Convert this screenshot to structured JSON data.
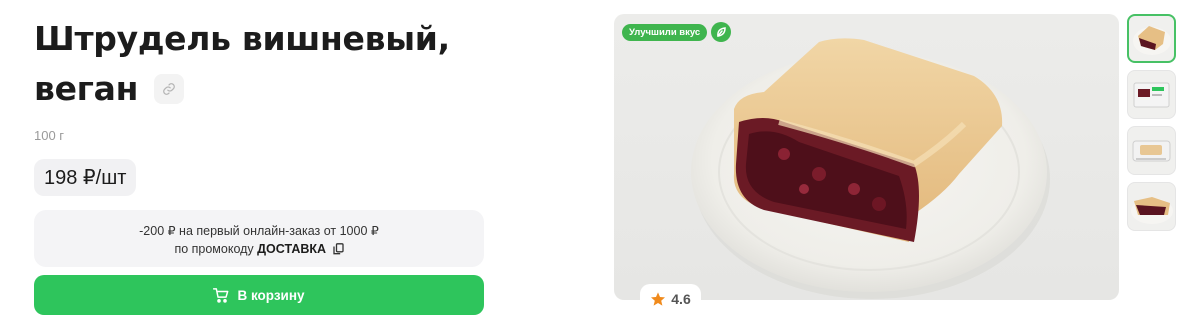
{
  "product": {
    "title_line1": "Штрудель вишневый,",
    "title_line2": "веган",
    "weight": "100 г",
    "price": "198 ₽/шт"
  },
  "promo": {
    "line1": "-200 ₽ на первый онлайн-заказ от 1000 ₽",
    "line2_prefix": "по промокоду ",
    "code": "ДОСТАВКА"
  },
  "cart": {
    "label": "В корзину"
  },
  "gallery": {
    "badge": "Улучшили вкус",
    "rating": "4.6",
    "thumbnails": [
      "strudel-plate",
      "package-front",
      "package-side",
      "strudel-closeup"
    ]
  },
  "colors": {
    "accent": "#2ec55c",
    "star": "#f08a1c",
    "badge": "#3fb54e"
  }
}
